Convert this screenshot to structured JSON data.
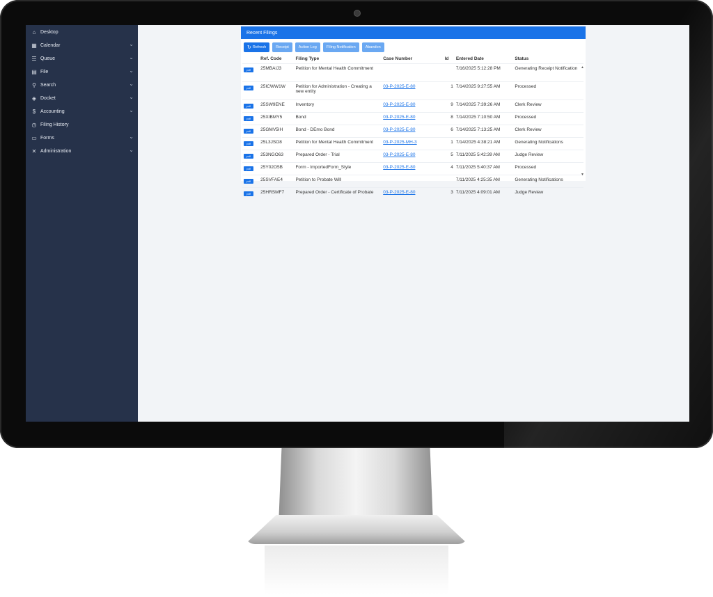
{
  "sidebar": {
    "items": [
      {
        "label": "Desktop",
        "icon": "home-icon",
        "chevron": false
      },
      {
        "label": "Calendar",
        "icon": "calendar-icon",
        "chevron": true
      },
      {
        "label": "Queue",
        "icon": "list-icon",
        "chevron": true
      },
      {
        "label": "File",
        "icon": "file-icon",
        "chevron": true
      },
      {
        "label": "Search",
        "icon": "search-icon",
        "chevron": true
      },
      {
        "label": "Docket",
        "icon": "docket-icon",
        "chevron": true
      },
      {
        "label": "Accounting",
        "icon": "dollar-icon",
        "chevron": true
      },
      {
        "label": "Filing History",
        "icon": "history-icon",
        "chevron": false
      },
      {
        "label": "Forms",
        "icon": "forms-icon",
        "chevron": true
      },
      {
        "label": "Administration",
        "icon": "tools-icon",
        "chevron": true
      }
    ]
  },
  "panel": {
    "title": "Recent Filings",
    "buttons": {
      "refresh": "Refresh",
      "receipt": "Receipt",
      "action_log": "Action Log",
      "filing_notification": "Filing Notification",
      "abandon": "Abandon"
    },
    "columns": [
      "",
      "Ref. Code",
      "Filing Type",
      "Case Number",
      "Id",
      "Entered Date",
      "Status"
    ],
    "pdf_label": "pdf",
    "rows": [
      {
        "ref": "25MBAIJ3",
        "type": "Petition for Mental Health Commitment",
        "case": "",
        "id": "",
        "date": "7/16/2025 5:12:28 PM",
        "status": "Generating Receipt Notification"
      },
      {
        "ref": "25ICWW1W",
        "type": "Petition for Administration - Creating a new entity",
        "case": "03-P-2025-E-80",
        "id": "1",
        "date": "7/14/2025 9:27:55 AM",
        "status": "Processed"
      },
      {
        "ref": "25SW9ENE",
        "type": "Inventory",
        "case": "03-P-2025-E-80",
        "id": "9",
        "date": "7/14/2025 7:39:26 AM",
        "status": "Clerk Review"
      },
      {
        "ref": "25XIBMY5",
        "type": "Bond",
        "case": "03-P-2025-E-80",
        "id": "8",
        "date": "7/14/2025 7:10:50 AM",
        "status": "Processed"
      },
      {
        "ref": "25GMV5IH",
        "type": "Bond - DEmo Bond",
        "case": "03-P-2025-E-80",
        "id": "6",
        "date": "7/14/2025 7:13:25 AM",
        "status": "Clerk Review"
      },
      {
        "ref": "25L3JSO8",
        "type": "Petition for Mental Health Commitment",
        "case": "03-P-2025-MH-3",
        "id": "1",
        "date": "7/14/2025 4:38:21 AM",
        "status": "Generating Notifications"
      },
      {
        "ref": "253NGO63",
        "type": "Prepared Order - Trial",
        "case": "03-P-2025-E-80",
        "id": "5",
        "date": "7/11/2025 5:42:39 AM",
        "status": "Judge Review"
      },
      {
        "ref": "25Y02O5B",
        "type": "Form - ImportedForm_Style",
        "case": "03-P-2025-E-80",
        "id": "4",
        "date": "7/11/2025 5:40:37 AM",
        "status": "Processed"
      },
      {
        "ref": "25SVFAE4",
        "type": "Petition to Probate Will",
        "case": "",
        "id": "",
        "date": "7/11/2025 4:25:35 AM",
        "status": "Generating Notifications"
      },
      {
        "ref": "25HRSMF7",
        "type": "Prepared Order - Certificate of Probate",
        "case": "03-P-2025-E-80",
        "id": "3",
        "date": "7/11/2025 4:09:01 AM",
        "status": "Judge Review"
      }
    ]
  },
  "colors": {
    "accent": "#1a73e8",
    "sidebar": "#26324a",
    "screen_bg": "#f2f4f7"
  }
}
